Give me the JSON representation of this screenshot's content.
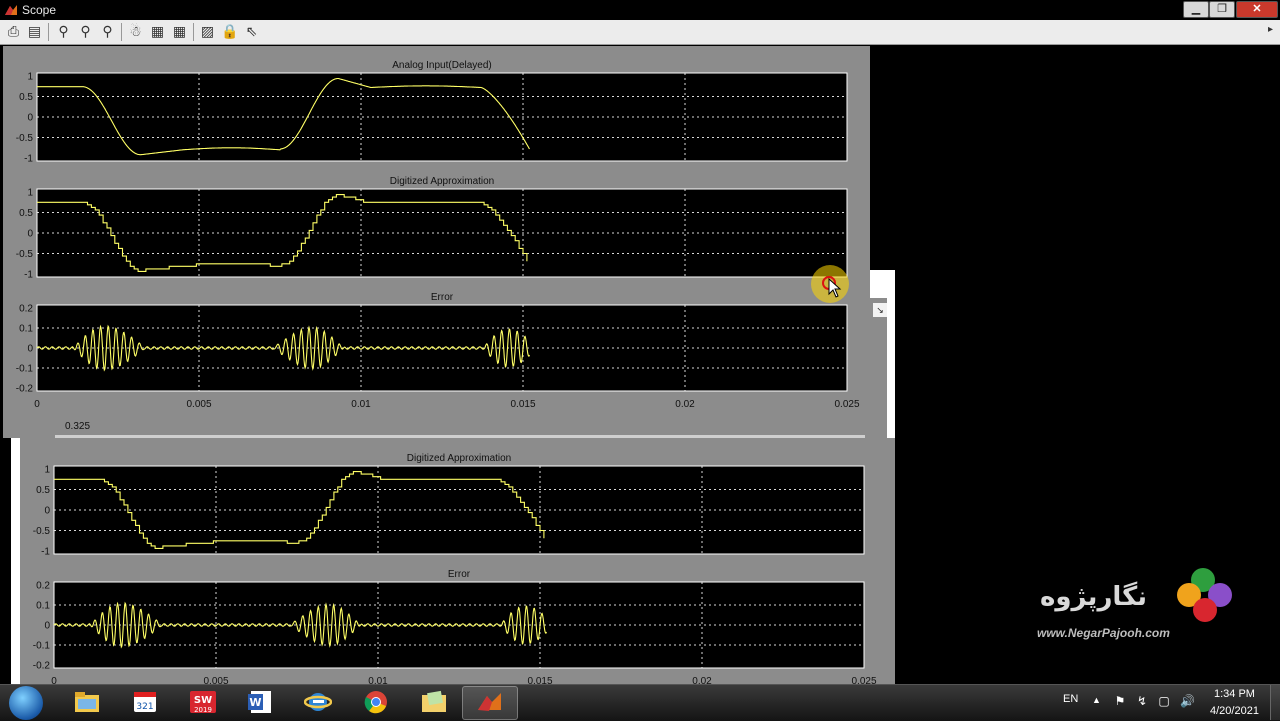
{
  "window": {
    "title": "Scope",
    "min_label": "▁",
    "max_label": "❐",
    "close_label": "✕"
  },
  "toolbar": {
    "icons": [
      "print-icon",
      "parameters-icon",
      "zoom-icon",
      "zoom-x-icon",
      "zoom-y-icon",
      "autoscale-icon",
      "save-axes-icon",
      "restore-axes-icon",
      "floating-scope-icon",
      "lock-axes-icon",
      "signal-selection-icon"
    ]
  },
  "colors": {
    "trace": "#ffff66",
    "axes_bg": "#000000",
    "figure_bg": "#8c8c8c"
  },
  "front_scope": {
    "x_ticks": [
      "0",
      "0.005",
      "0.01",
      "0.015",
      "0.02",
      "0.025"
    ],
    "xlim": [
      0,
      0.025
    ],
    "plots": [
      {
        "title": "Analog Input(Delayed)",
        "y_ticks": [
          "1",
          "0.5",
          "0",
          "-0.5",
          "-1"
        ],
        "ylim": [
          -1,
          1
        ],
        "kind": "analog"
      },
      {
        "title": "Digitized Approximation",
        "y_ticks": [
          "1",
          "0.5",
          "0",
          "-0.5",
          "-1"
        ],
        "ylim": [
          -1,
          1
        ],
        "kind": "digital"
      },
      {
        "title": "Error",
        "y_ticks": [
          "0.2",
          "0.1",
          "0",
          "-0.1",
          "-0.2"
        ],
        "ylim": [
          -0.2,
          0.2
        ],
        "kind": "error"
      }
    ]
  },
  "back_scope": {
    "slider_value": "0.325",
    "x_ticks": [
      "0",
      "0.005",
      "0.01",
      "0.015",
      "0.02",
      "0.025"
    ],
    "plots": [
      {
        "title": "Digitized Approximation",
        "y_ticks": [
          "1",
          "0.5",
          "0",
          "-0.5",
          "-1"
        ],
        "ylim": [
          -1,
          1
        ],
        "kind": "digital"
      },
      {
        "title": "Error",
        "y_ticks": [
          "0.2",
          "0.1",
          "0",
          "-0.1",
          "-0.2"
        ],
        "ylim": [
          -0.2,
          0.2
        ],
        "kind": "error"
      }
    ]
  },
  "watermark": {
    "logo_text": "نگارپژوه",
    "url": "www.NegarPajooh.com"
  },
  "taskbar": {
    "apps": [
      {
        "name": "file-explorer",
        "icon": "folder-icon"
      },
      {
        "name": "media-player",
        "icon": "media-player-icon"
      },
      {
        "name": "solidworks",
        "icon": "solidworks-icon",
        "label": "SW 2019"
      },
      {
        "name": "word",
        "icon": "word-icon",
        "label": "W"
      },
      {
        "name": "ie",
        "icon": "internet-explorer-icon"
      },
      {
        "name": "chrome",
        "icon": "chrome-icon"
      },
      {
        "name": "notes",
        "icon": "folder-notes-icon"
      },
      {
        "name": "matlab",
        "icon": "matlab-icon",
        "active": true
      }
    ],
    "language": "EN",
    "time": "1:34 PM",
    "date": "4/20/2021"
  }
}
